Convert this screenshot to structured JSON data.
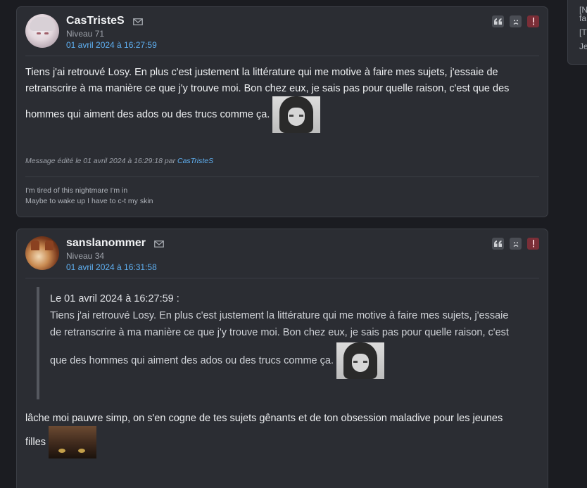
{
  "sidebar": {
    "lines": [
      "[N",
      "fa",
      "[T",
      "Je"
    ]
  },
  "post1": {
    "username": "CasTristeS",
    "level": "Niveau 71",
    "date": "01 avril 2024 à 16:27:59",
    "body_line1": "Tiens j'ai retrouvé Losy. En plus c'est justement la littérature qui me motive à faire mes sujets, j'essaie de",
    "body_line2": "retranscrire à ma manière ce que j'y trouve moi. Bon chez eux, je sais pas pour quelle raison, c'est que des",
    "body_line3": "hommes qui aiment des ados ou des trucs comme ça.",
    "edited_prefix": "Message édité le 01 avril 2024 à 16:29:18 par",
    "edited_by": "CasTristeS",
    "signature_line1": "I'm tired of this nightmare I'm in",
    "signature_line2": "Maybe to wake up I have to c-t my skin",
    "actions": {
      "quote": "quote-icon",
      "kick": "sad-face-icon",
      "alert": "alert-icon"
    }
  },
  "post2": {
    "username": "sanslanommer",
    "level": "Niveau 34",
    "date": "01 avril 2024 à 16:31:58",
    "quote_header": "Le 01 avril 2024 à 16:27:59 :",
    "quote_line1": "Tiens j'ai retrouvé Losy. En plus c'est justement la littérature qui me motive à faire mes sujets, j'essaie",
    "quote_line2": "de retranscrire à ma manière ce que j'y trouve moi. Bon chez eux, je sais pas pour quelle raison, c'est",
    "quote_line3": "que des hommes qui aiment des ados ou des trucs comme ça.",
    "body_line1": "lâche moi pauvre simp, on s'en cogne de tes sujets gênants et de ton obsession maladive pour les jeunes",
    "body_line2": "filles"
  },
  "colors": {
    "background": "#1b1c21",
    "card": "#2b2d33",
    "link": "#5fb0f2",
    "alert": "#7a2e37"
  }
}
